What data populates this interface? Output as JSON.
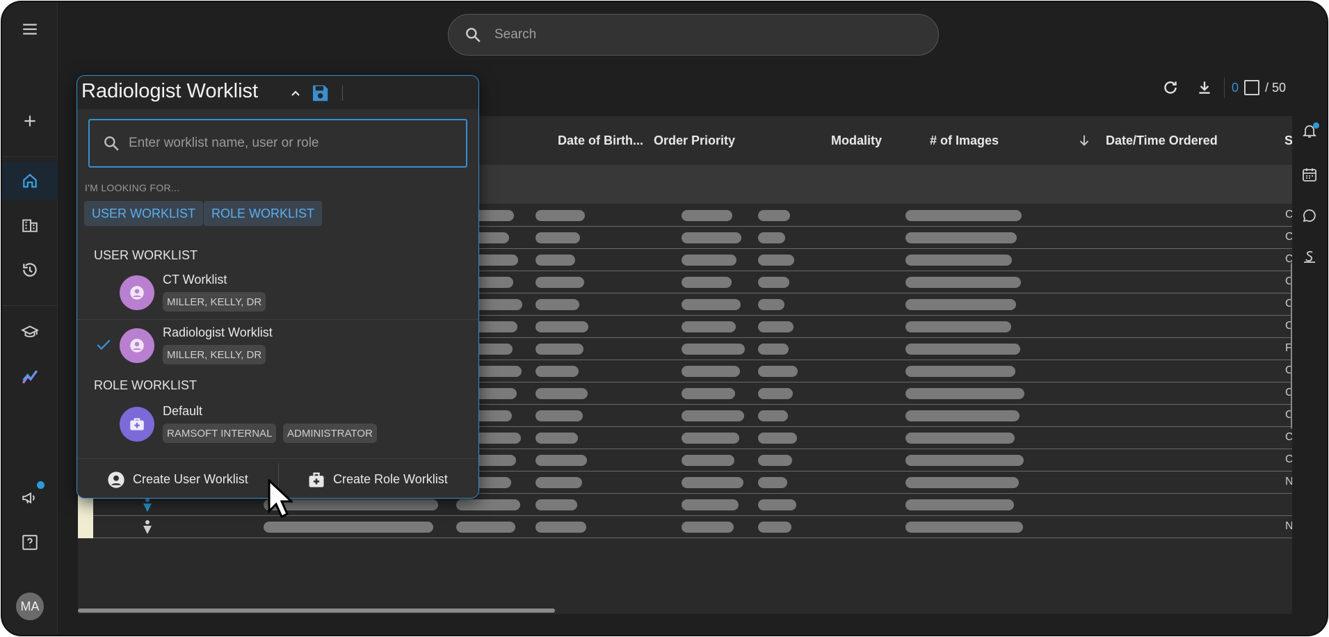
{
  "search": {
    "placeholder": "Search"
  },
  "nav": {
    "user_initials": "MA",
    "items": [
      "menu-icon",
      "add-icon",
      "home-icon",
      "building-icon",
      "history-icon",
      "graduation-cap-icon",
      "analytics-icon",
      "megaphone-icon",
      "help-icon"
    ]
  },
  "toolbar": {
    "selected_count": "0",
    "total": "/ 50"
  },
  "table": {
    "columns": [
      "Date of Birth...",
      "Order Priority",
      "Modality",
      "# of Images",
      "Date/Time Ordered",
      "S"
    ],
    "status_letters": [
      "C",
      "C",
      "C",
      "C",
      "C",
      "C",
      "F",
      "C",
      "C",
      "C",
      "C",
      "C",
      "N",
      "",
      "N"
    ]
  },
  "worklist": {
    "title": "Radiologist Worklist",
    "search_placeholder": "Enter worklist name, user or role",
    "looking_for": "I'M LOOKING FOR...",
    "filters": [
      "USER WORKLIST",
      "ROLE WORKLIST"
    ],
    "user_section": "USER WORKLIST",
    "role_section": "ROLE WORKLIST",
    "user_items": [
      {
        "name": "CT Worklist",
        "tags": [
          "MILLER, KELLY, DR"
        ],
        "selected": false
      },
      {
        "name": "Radiologist Worklist",
        "tags": [
          "MILLER, KELLY, DR"
        ],
        "selected": true
      }
    ],
    "role_items": [
      {
        "name": "Default",
        "tags": [
          "RAMSOFT INTERNAL",
          "ADMINISTRATOR"
        ]
      }
    ],
    "create_user": "Create User Worklist",
    "create_role": "Create Role Worklist"
  },
  "colors": {
    "accent": "#3a8fd1",
    "user_avatar": "#b97fd0",
    "role_avatar": "#7b6ad8",
    "chip_text": "#5aaef0"
  }
}
